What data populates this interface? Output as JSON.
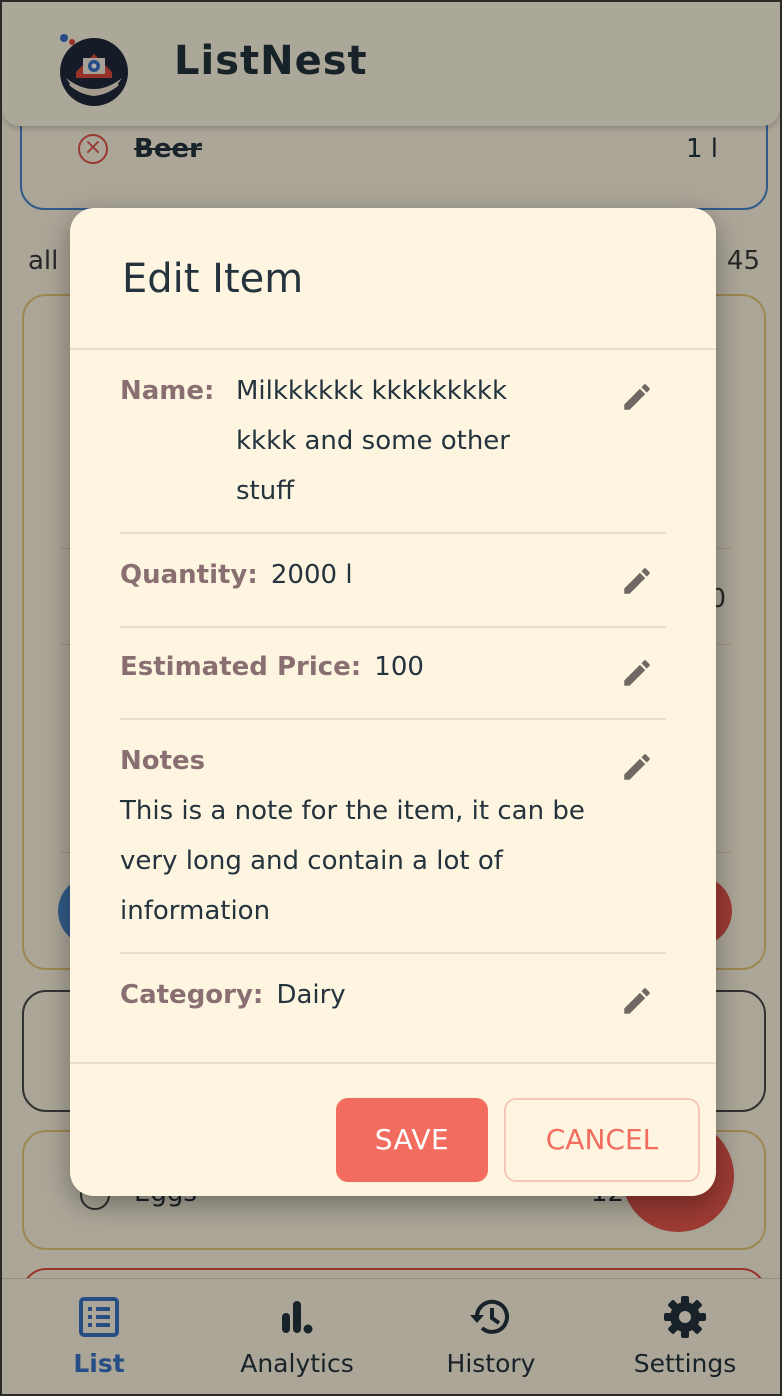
{
  "app": {
    "title": "ListNest"
  },
  "background_list": {
    "beer": {
      "name": "Beer",
      "quantity": "1 l"
    },
    "summary_left": "all",
    "summary_right": "45",
    "partial_value": "0",
    "eggs": {
      "name": "Eggs",
      "quantity": "12"
    }
  },
  "dialog": {
    "title": "Edit Item",
    "fields": {
      "name": {
        "label": "Name:",
        "value": "Milkkkkkk kkkkkkkkk kkkk and some other stuff"
      },
      "quantity": {
        "label": "Quantity:",
        "value": "2000 l"
      },
      "price": {
        "label": "Estimated Price:",
        "value": "100"
      },
      "notes": {
        "label": "Notes",
        "value": "This is a note for the item, it can be very long and contain a lot of information"
      },
      "category": {
        "label": "Category:",
        "value": "Dairy"
      }
    },
    "buttons": {
      "save": "SAVE",
      "cancel": "CANCEL"
    }
  },
  "nav": {
    "items": [
      {
        "label": "List",
        "icon": "list-icon",
        "active": true
      },
      {
        "label": "Analytics",
        "icon": "analytics-icon",
        "active": false
      },
      {
        "label": "History",
        "icon": "history-icon",
        "active": false
      },
      {
        "label": "Settings",
        "icon": "settings-icon",
        "active": false
      }
    ]
  },
  "colors": {
    "accent_blue": "#3a72c4",
    "save": "#f26d5f",
    "label": "#8a6f72",
    "background": "#fdf5e0"
  }
}
